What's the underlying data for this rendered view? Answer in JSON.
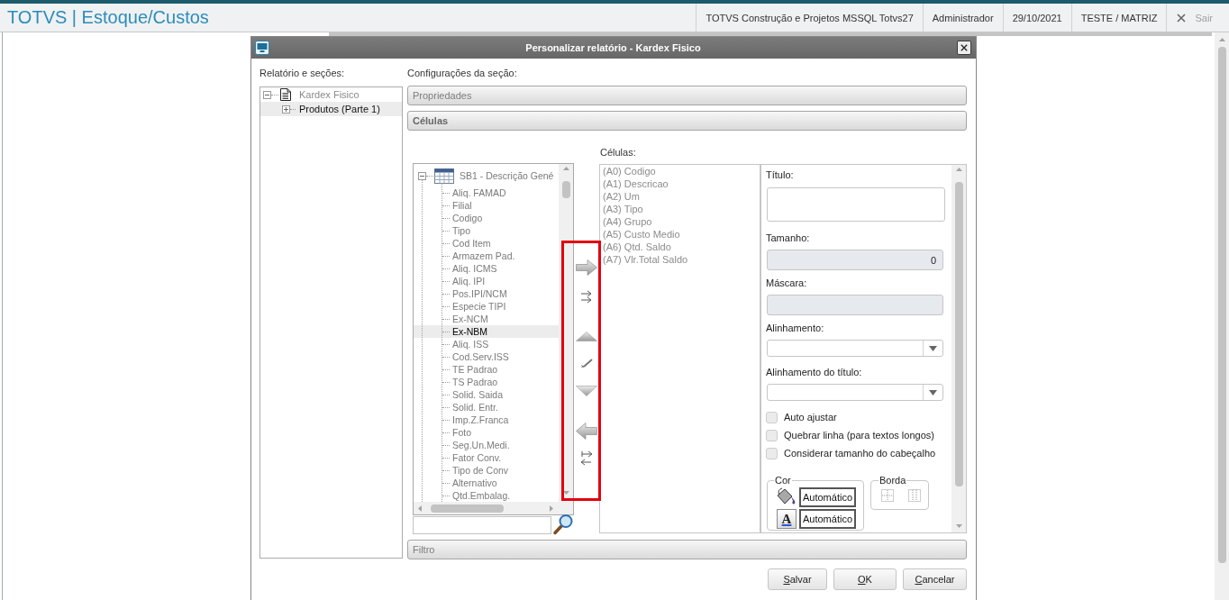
{
  "header": {
    "title": "TOTVS | Estoque/Custos",
    "info": [
      "TOTVS Construção e Projetos MSSQL Totvs27",
      "Administrador",
      "29/10/2021",
      "TESTE / MATRIZ"
    ],
    "logout": {
      "label": "Sair",
      "disabled": true
    }
  },
  "dialog": {
    "title": "Personalizar relatório - Kardex Fisico",
    "report_tree": {
      "label": "Relatório e seções:",
      "items": [
        {
          "label": "Kardex Fisico",
          "expanded": true,
          "selected": false,
          "children": [
            {
              "label": "Produtos (Parte 1)",
              "expanded": false,
              "selected": true
            }
          ]
        }
      ]
    },
    "section_settings": {
      "label": "Configurações da seção:",
      "sections": [
        {
          "label": "Propriedades",
          "expanded": false
        },
        {
          "label": "Células",
          "expanded": true
        },
        {
          "label": "Filtro",
          "expanded": false
        }
      ]
    },
    "cells": {
      "field_tree": {
        "label": "SB1 - Descrição Gené",
        "expanded": true,
        "children": [
          {
            "label": "Aliq. FAMAD",
            "selected": false
          },
          {
            "label": "Filial",
            "selected": false
          },
          {
            "label": "Codigo",
            "selected": false
          },
          {
            "label": "Tipo",
            "selected": false
          },
          {
            "label": "Cod Item",
            "selected": false
          },
          {
            "label": "Armazem Pad.",
            "selected": false
          },
          {
            "label": "Aliq. ICMS",
            "selected": false
          },
          {
            "label": "Aliq. IPI",
            "selected": false
          },
          {
            "label": "Pos.IPI/NCM",
            "selected": false
          },
          {
            "label": "Especie TIPI",
            "selected": false
          },
          {
            "label": "Ex-NCM",
            "selected": false
          },
          {
            "label": "Ex-NBM",
            "selected": true
          },
          {
            "label": "Aliq. ISS",
            "selected": false
          },
          {
            "label": "Cod.Serv.ISS",
            "selected": false
          },
          {
            "label": "TE Padrao",
            "selected": false
          },
          {
            "label": "TS Padrao",
            "selected": false
          },
          {
            "label": "Solid. Saida",
            "selected": false
          },
          {
            "label": "Solid. Entr.",
            "selected": false
          },
          {
            "label": "Imp.Z.Franca",
            "selected": false
          },
          {
            "label": "Foto",
            "selected": false
          },
          {
            "label": "Seg.Un.Medi.",
            "selected": false
          },
          {
            "label": "Fator Conv.",
            "selected": false
          },
          {
            "label": "Tipo de Conv",
            "selected": false
          },
          {
            "label": "Alternativo",
            "selected": false
          },
          {
            "label": "Qtd.Embalag.",
            "selected": false
          }
        ]
      },
      "list_label": "Células:",
      "list": [
        "(A0) Codigo",
        "(A1) Descricao",
        "(A2) Um",
        "(A3) Tipo",
        "(A4) Grupo",
        "(A5) Custo Medio",
        "(A6) Qtd. Saldo",
        "(A7) Vlr.Total Saldo"
      ],
      "properties": {
        "fields": [
          {
            "kind": "textarea",
            "label": "Título:",
            "disabled": false
          },
          {
            "kind": "text",
            "label": "Tamanho:",
            "value": "0",
            "disabled": true
          },
          {
            "kind": "text",
            "label": "Máscara:",
            "disabled": true
          },
          {
            "kind": "select",
            "label": "Alinhamento:",
            "disabled": false
          },
          {
            "kind": "select",
            "label": "Alinhamento do título:",
            "disabled": false
          }
        ],
        "options": [
          {
            "label": "Auto ajustar",
            "checked": false
          },
          {
            "label": "Quebrar linha (para textos longos)",
            "checked": false
          },
          {
            "label": "Considerar tamanho do cabeçalho",
            "checked": false
          }
        ],
        "color_group": {
          "label": "Cor",
          "font_symbol": "A",
          "buttons": [
            "Automático",
            "Automático"
          ]
        },
        "border_group": {
          "label": "Borda"
        }
      }
    },
    "buttons": [
      "Salvar",
      "OK",
      "Cancelar"
    ]
  }
}
